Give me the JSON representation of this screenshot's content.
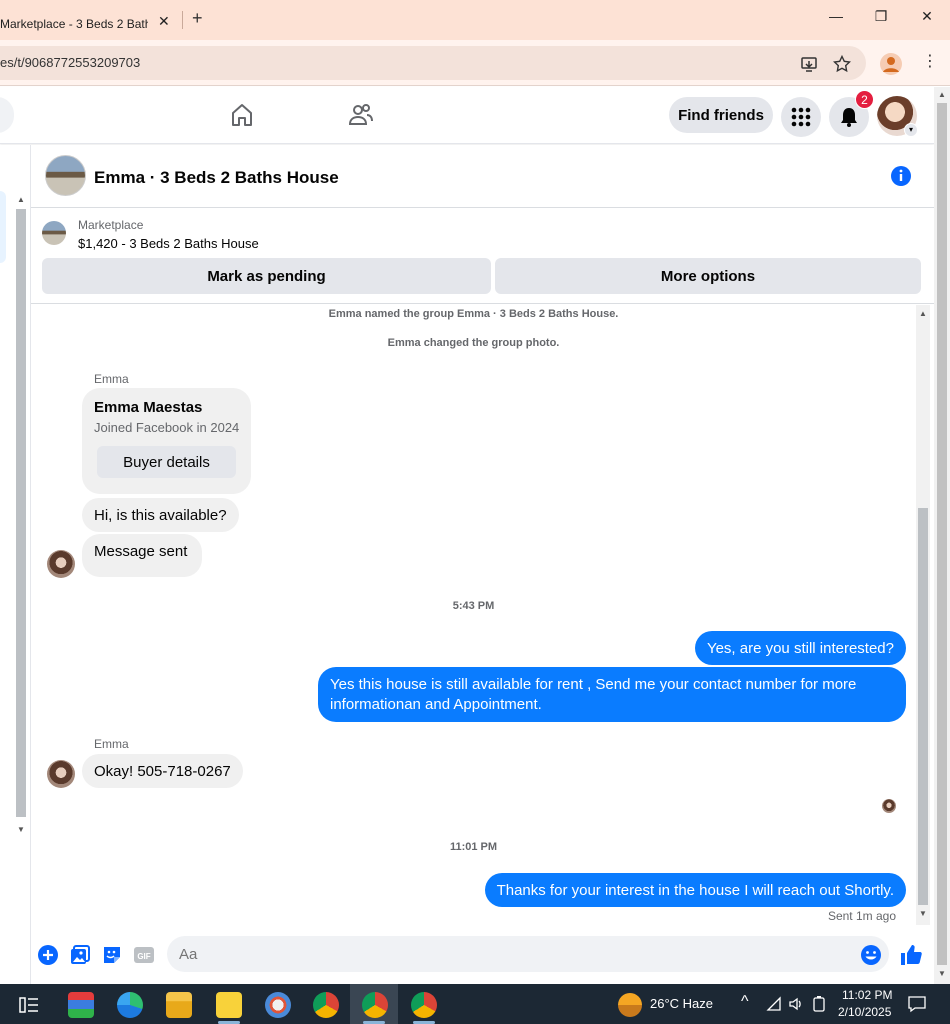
{
  "browser": {
    "tab_title": "Marketplace - 3 Beds 2 Bath",
    "tab_close": "✕",
    "new_tab": "+",
    "url": "es/t/9068772553209703",
    "window_minimize": "—",
    "window_restore": "❐",
    "window_close": "✕"
  },
  "nav": {
    "find_friends": "Find friends",
    "notifications_count": "2"
  },
  "chat": {
    "title": "Emma · 3 Beds 2 Baths House"
  },
  "marketplace": {
    "label": "Marketplace",
    "item": "$1,420 - 3 Beds 2 Baths House",
    "mark_pending": "Mark as pending",
    "more_options": "More options"
  },
  "thread": {
    "system_1": "Emma named the group Emma · 3 Beds 2 Baths House.",
    "system_2": "Emma changed the group photo.",
    "sender_1": "Emma",
    "card_name": "Emma Maestas",
    "card_sub": "Joined Facebook in 2024",
    "card_button": "Buyer details",
    "msg_in_1": "Hi, is this available?",
    "msg_in_2": "Message sent",
    "time_1": "5:43 PM",
    "msg_out_1": "Yes, are you still interested?",
    "msg_out_2": "Yes this house is still available for rent , Send me your contact number for more informationan and Appointment.",
    "sender_2": "Emma",
    "msg_in_3": "Okay! 505-718-0267",
    "time_2": "11:01 PM",
    "msg_out_3": "Thanks for your interest in the house I will reach out Shortly.",
    "sent_status": "Sent 1m ago"
  },
  "composer": {
    "placeholder": "Aa"
  },
  "taskbar": {
    "weather": "26°C  Haze",
    "time": "11:02 PM",
    "date": "2/10/2025"
  },
  "colors": {
    "messenger_blue": "#0a7cff",
    "fb_blue": "#0866ff",
    "badge_red": "#e41e3f"
  }
}
